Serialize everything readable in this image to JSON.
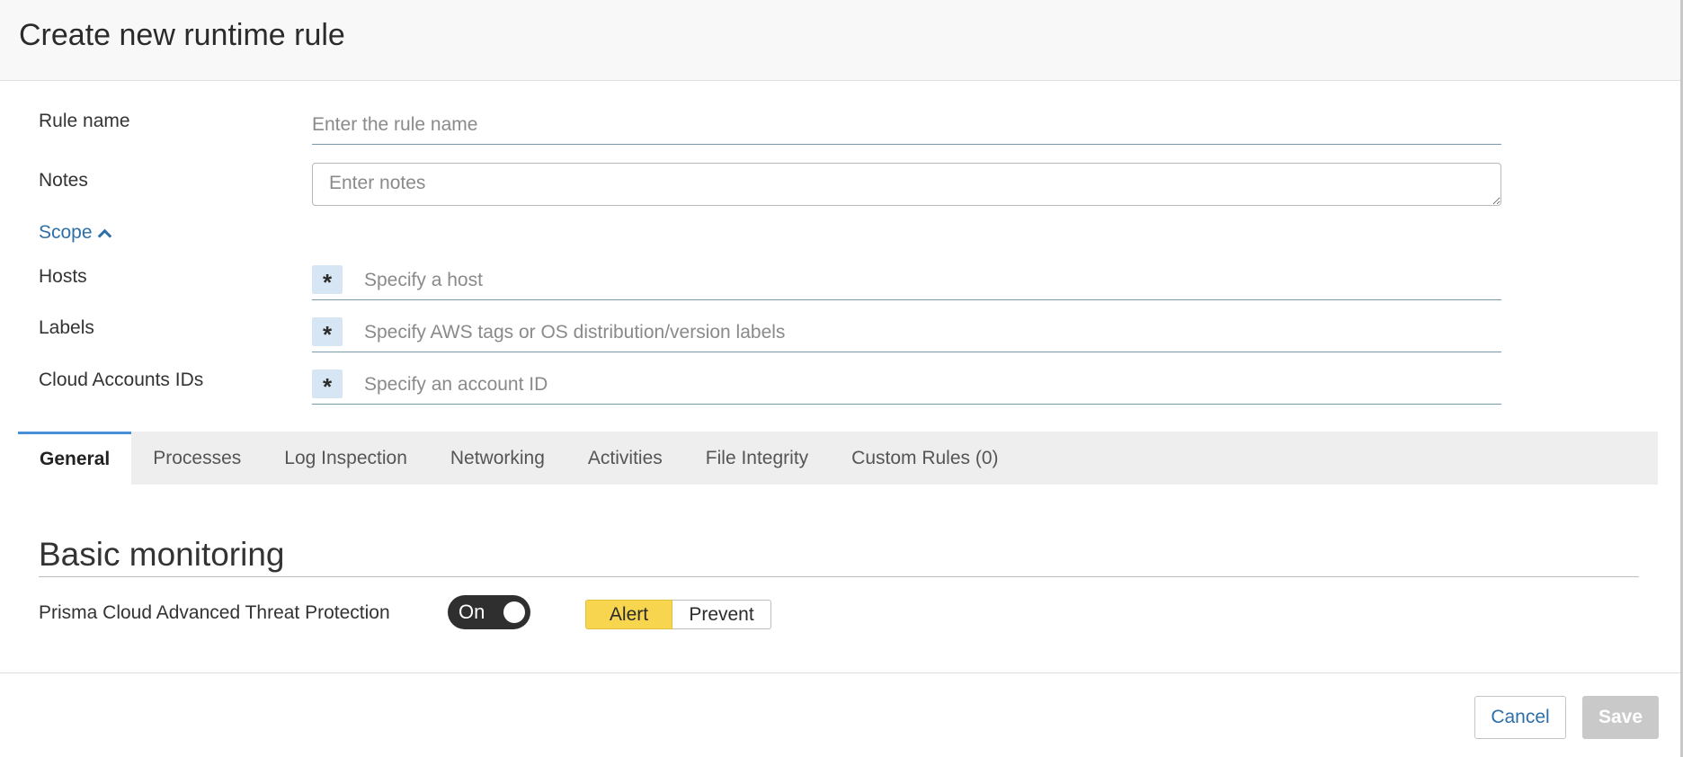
{
  "dialog": {
    "title": "Create new runtime rule"
  },
  "form": {
    "rule_name": {
      "label": "Rule name",
      "placeholder": "Enter the rule name",
      "value": ""
    },
    "notes": {
      "label": "Notes",
      "placeholder": "Enter notes",
      "value": ""
    }
  },
  "scope": {
    "toggle_label": "Scope",
    "expanded": true,
    "rows": [
      {
        "label": "Hosts",
        "badge": "*",
        "placeholder": "Specify a host"
      },
      {
        "label": "Labels",
        "badge": "*",
        "placeholder": "Specify AWS tags or OS distribution/version labels"
      },
      {
        "label": "Cloud Accounts IDs",
        "badge": "*",
        "placeholder": "Specify an account ID"
      }
    ]
  },
  "tabs": [
    {
      "label": "General",
      "active": true
    },
    {
      "label": "Processes",
      "active": false
    },
    {
      "label": "Log Inspection",
      "active": false
    },
    {
      "label": "Networking",
      "active": false
    },
    {
      "label": "Activities",
      "active": false
    },
    {
      "label": "File Integrity",
      "active": false
    },
    {
      "label": "Custom Rules (0)",
      "active": false
    }
  ],
  "general": {
    "section_title": "Basic monitoring",
    "atp": {
      "label": "Prisma Cloud Advanced Threat Protection",
      "toggle_text": "On",
      "enabled": true,
      "modes": [
        "Alert",
        "Prevent"
      ],
      "selected_mode": "Alert"
    }
  },
  "footer": {
    "cancel_label": "Cancel",
    "save_label": "Save",
    "save_disabled": true
  },
  "colors": {
    "accent_blue": "#2e6fa7",
    "active_tab_border": "#4a90d9",
    "alert_yellow": "#f7d54e",
    "badge_bg": "#d7e6f4",
    "toggle_bg": "#2f2f2f",
    "disabled_button": "#c9c9c9"
  }
}
